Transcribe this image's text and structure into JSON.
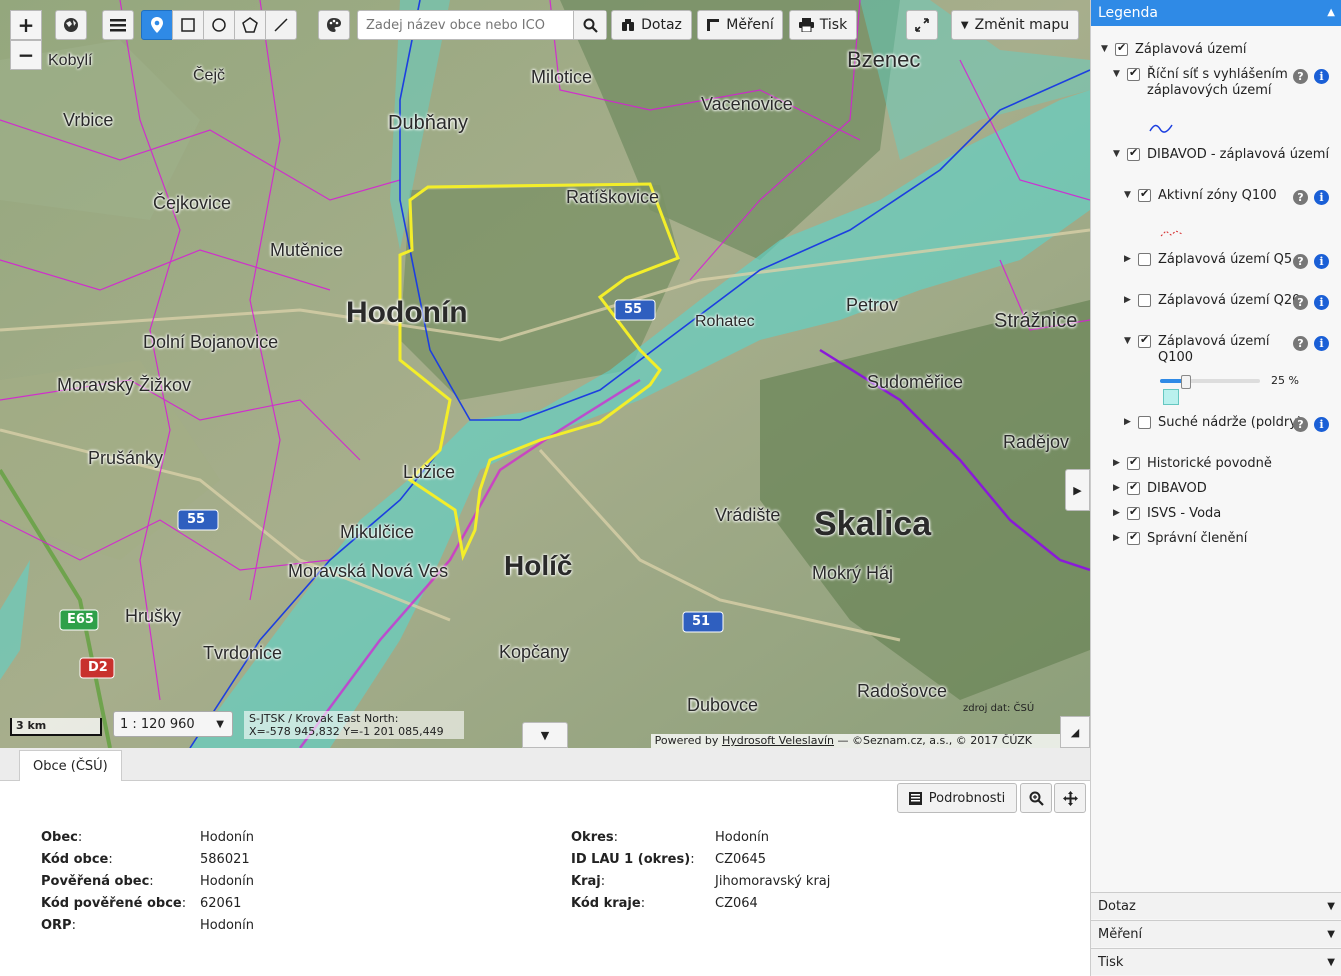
{
  "toolbar": {
    "zoom_in": "+",
    "zoom_out": "−",
    "search_placeholder": "Zadej název obce nebo IČO",
    "query_label": "Dotaz",
    "measure_label": "Měření",
    "print_label": "Tisk",
    "change_map_label": "Změnit mapu"
  },
  "map": {
    "place_labels": [
      "Kobylí",
      "Čejč",
      "Vrbice",
      "Dubňany",
      "Milotice",
      "Vacenovice",
      "Bzenec",
      "Čejkovice",
      "Ratíškovice",
      "Mutěnice",
      "Hodonín",
      "Petrov",
      "Strážnice",
      "Dolní Bojanovice",
      "Moravský Žižkov",
      "Sudoměřice",
      "Prušánky",
      "Lužice",
      "Radějov",
      "Mikulčice",
      "Skalica",
      "Holíč",
      "Vrádište",
      "Moravská Nová Ves",
      "Mokrý Háj",
      "Hrušky",
      "Tvrdonice",
      "Kopčany",
      "Radošovce",
      "Dubovce",
      "Rohatec"
    ],
    "road_labels": [
      "55",
      "55",
      "51",
      "E65",
      "D2"
    ],
    "scale_bar_label": "3 km",
    "scale_value": "1 : 120 960",
    "coords_line1": "S-JTSK / Krovak East North:",
    "coords_line2": "X=-578 945,832 Y=-1 201 085,449",
    "source_label": "zdroj dat: ČSÚ",
    "attribution_prefix": "Powered by ",
    "attribution_link": "Hydrosoft Veleslavín",
    "attribution_suffix": " — ©Seznam.cz, a.s., © 2017 ČÚZK"
  },
  "bottom": {
    "tab_label": "Obce (ČSÚ)",
    "details_label": "Podrobnosti",
    "left_fields": [
      {
        "key": "Obec",
        "value": "Hodonín"
      },
      {
        "key": "Kód obce",
        "value": "586021"
      },
      {
        "key": "Pověřená obec",
        "value": "Hodonín"
      },
      {
        "key": "Kód pověřené obce",
        "value": "62061"
      },
      {
        "key": "ORP",
        "value": "Hodonín"
      }
    ],
    "right_fields": [
      {
        "key": "Okres",
        "value": "Hodonín"
      },
      {
        "key": "ID LAU 1 (okres)",
        "value": "CZ0645"
      },
      {
        "key": "Kraj",
        "value": "Jihomoravský kraj"
      },
      {
        "key": "Kód kraje",
        "value": "CZ064"
      }
    ]
  },
  "legend": {
    "title": "Legenda",
    "items": [
      {
        "label": "Záplavová území",
        "checked": true
      },
      {
        "label": "Říční síť s vyhlášením záplavových území",
        "checked": true
      },
      {
        "label": "DIBAVOD - záplavová území",
        "checked": true
      },
      {
        "label": "Aktivní zóny Q100",
        "checked": true
      },
      {
        "label": "Záplavová území Q5",
        "checked": false
      },
      {
        "label": "Záplavová území Q20",
        "checked": false
      },
      {
        "label": "Záplavová území Q100",
        "checked": true
      },
      {
        "label": "Suché nádrže (poldry)",
        "checked": false
      },
      {
        "label": "Historické povodně",
        "checked": true
      },
      {
        "label": "DIBAVOD",
        "checked": true
      },
      {
        "label": "ISVS - Voda",
        "checked": true
      },
      {
        "label": "Správní členění",
        "checked": true
      }
    ],
    "opacity_value": "25 %",
    "opacity_fraction": 0.25,
    "accordion": [
      "Dotaz",
      "Měření",
      "Tisk"
    ]
  },
  "colors": {
    "accent": "#2f8ae6",
    "municipality_outline": "#f3ee2a",
    "flood_zone": "#5fd2c8",
    "admin_border": "#d81ad8",
    "river": "#1c3fe0"
  }
}
